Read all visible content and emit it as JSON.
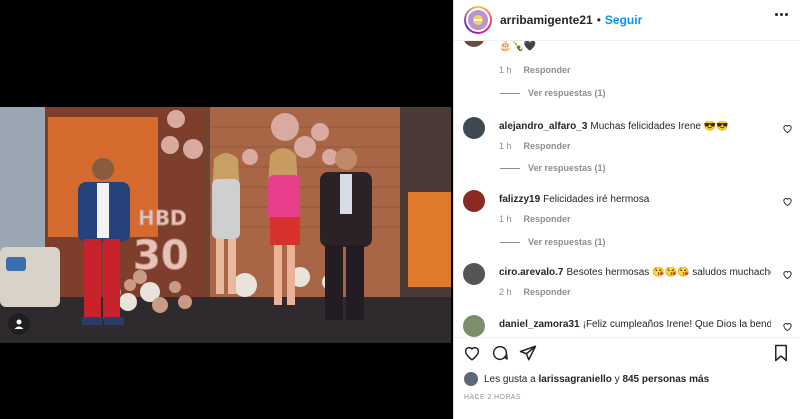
{
  "header": {
    "username": "arribamigente21",
    "separator": "•",
    "follow_label": "Seguir",
    "more_icon": "more-options-icon"
  },
  "top_comment": {
    "text": "🎂🍾🖤",
    "time": "1 h",
    "reply_label": "Responder",
    "view_replies": "Ver respuestas (1)"
  },
  "comments": [
    {
      "user": "alejandro_alfaro_3",
      "text": "Muchas felicidades Irene 😎😎",
      "time": "1 h",
      "reply_label": "Responder",
      "view_replies": "Ver respuestas (1)",
      "avatar_color": "#3d4a52"
    },
    {
      "user": "falizzy19",
      "text": "Felicidades iré hermosa",
      "time": "1 h",
      "reply_label": "Responder",
      "view_replies": "Ver respuestas (1)",
      "avatar_color": "#8a2a22"
    },
    {
      "user": "ciro.arevalo.7",
      "text": "Besotes hermosas 😘😘😘 saludos muchachos",
      "time": "2 h",
      "reply_label": "Responder",
      "view_replies": "",
      "avatar_color": "#555555"
    },
    {
      "user": "daniel_zamora31",
      "text": "¡Feliz cumpleaños Irene! Que Dios la bendiga",
      "time": "",
      "reply_label": "",
      "view_replies": "",
      "avatar_color": "#7b8f6a"
    }
  ],
  "actions": {
    "like_icon": "heart-icon",
    "comment_icon": "comment-icon",
    "share_icon": "share-icon",
    "save_icon": "bookmark-icon"
  },
  "likes": {
    "prefix": "Les gusta a",
    "user": "larissagraniello",
    "suffix": "y",
    "count": "845 personas más"
  },
  "posted": "HACE 2 HORAS",
  "photo": {
    "balloon_text": "HBD",
    "balloon_number": "30"
  },
  "colors": {
    "accent": "#0095f6",
    "text": "#262626",
    "muted": "#8e8e8e"
  }
}
